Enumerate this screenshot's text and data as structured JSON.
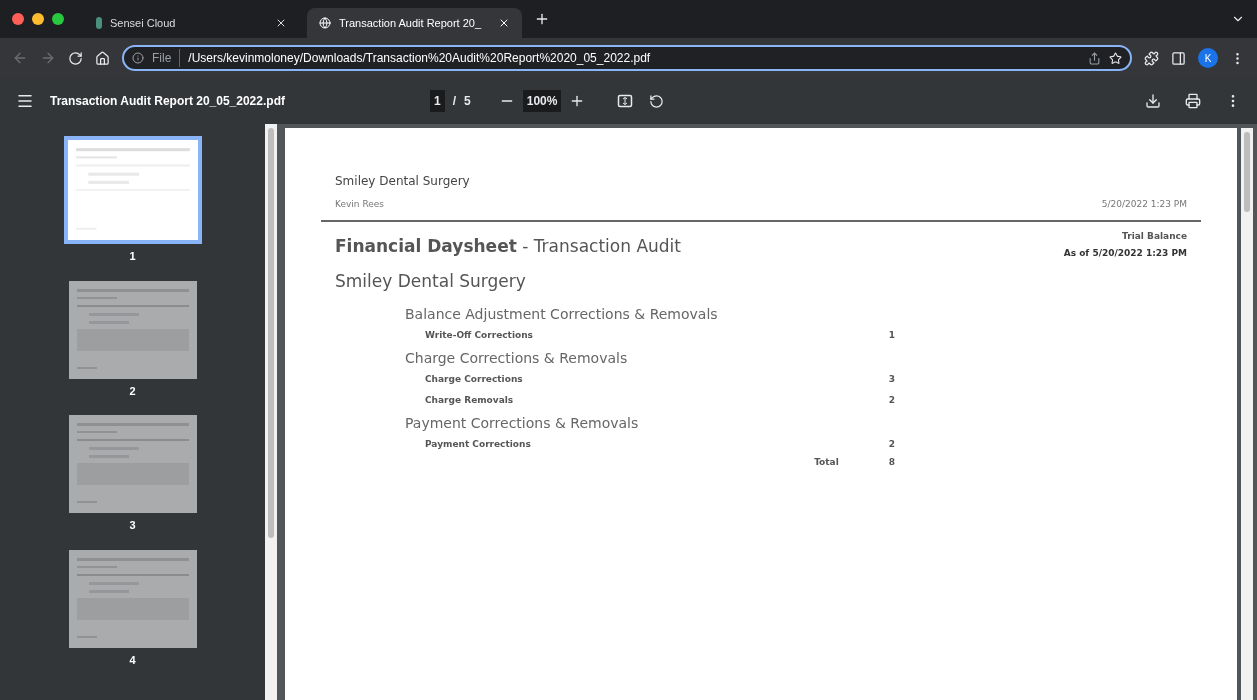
{
  "tabs": [
    {
      "title": "Sensei Cloud",
      "selected": false
    },
    {
      "title": "Transaction Audit Report 20_",
      "selected": true
    }
  ],
  "address": {
    "scheme": "File",
    "url": "/Users/kevinmoloney/Downloads/Transaction%20Audit%20Report%2020_05_2022.pdf"
  },
  "profile": {
    "initial": "K"
  },
  "pdf_toolbar": {
    "filename": "Transaction Audit Report 20_05_2022.pdf",
    "page": "1",
    "separator": "/",
    "page_total": "5",
    "zoom": "100%"
  },
  "thumbnails": [
    {
      "label": "1",
      "selected": true
    },
    {
      "label": "2",
      "selected": false
    },
    {
      "label": "3",
      "selected": false
    },
    {
      "label": "4",
      "selected": false
    }
  ],
  "document": {
    "practice": "Smiley Dental Surgery",
    "user": "Kevin Rees",
    "printed": "5/20/2022 1:23 PM",
    "title": "**Financial Daysheet** - Transaction Audit",
    "report_type": "Trial Balance",
    "as_of": "As of 5/20/2022 1:23 PM",
    "location": "Smiley Dental Surgery",
    "sections": [
      {
        "heading": "Balance Adjustment Corrections & Removals",
        "items": [
          {
            "label": "Write-Off Corrections",
            "count": "1"
          }
        ]
      },
      {
        "heading": "Charge Corrections & Removals",
        "items": [
          {
            "label": "Charge Corrections",
            "count": "3"
          },
          {
            "label": "Charge Removals",
            "count": "2"
          }
        ]
      },
      {
        "heading": "Payment Corrections & Removals",
        "items": [
          {
            "label": "Payment Corrections",
            "count": "2"
          }
        ]
      }
    ],
    "total_label": "Total",
    "total": "8"
  }
}
